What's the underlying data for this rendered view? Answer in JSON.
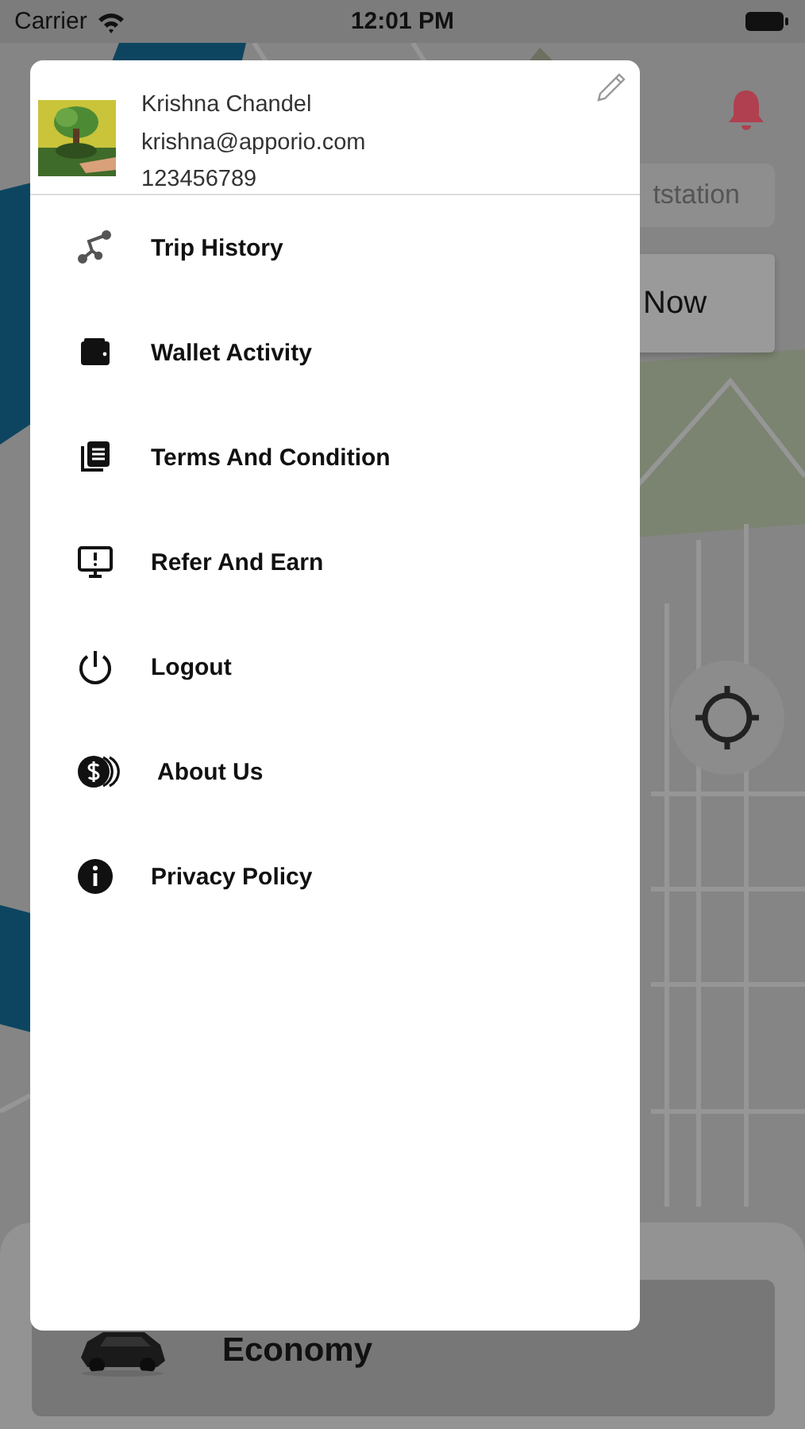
{
  "status_bar": {
    "carrier": "Carrier",
    "time": "12:01 PM"
  },
  "map_overlay": {
    "search_field": {
      "value": "tstation"
    },
    "now_button": {
      "label": "Now"
    },
    "ride_option": {
      "label": "Economy"
    }
  },
  "drawer": {
    "profile": {
      "name": "Krishna Chandel",
      "email": "krishna@apporio.com",
      "phone": "123456789"
    },
    "menu": [
      {
        "label": "Trip History",
        "kind": "route"
      },
      {
        "label": "Wallet Activity",
        "kind": "wallet"
      },
      {
        "label": "Terms And Condition",
        "kind": "document"
      },
      {
        "label": "Refer And Earn",
        "kind": "monitor"
      },
      {
        "label": "Logout",
        "kind": "power"
      },
      {
        "label": "About Us",
        "kind": "coins"
      },
      {
        "label": "Privacy Policy",
        "kind": "info"
      }
    ]
  }
}
